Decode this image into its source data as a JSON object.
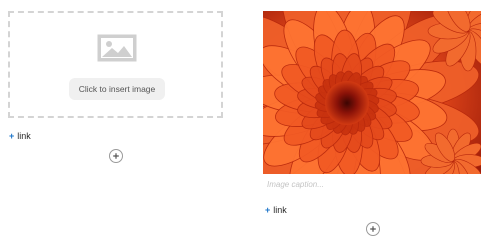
{
  "left_block": {
    "insert_label": "Click to insert image",
    "placeholder_icon": "image-icon",
    "link_plus": "+",
    "link_label": "link",
    "add_icon": "plus-icon"
  },
  "right_block": {
    "photo_subject": "orange-flower-photo",
    "caption_placeholder": "Image caption...",
    "link_plus": "+",
    "link_label": "link",
    "add_icon": "plus-icon"
  },
  "colors": {
    "link_plus": "#1a73c8",
    "placeholder_border": "#d4d4d4",
    "flower_primary": "#e8501c",
    "flower_center": "#8a1208"
  }
}
